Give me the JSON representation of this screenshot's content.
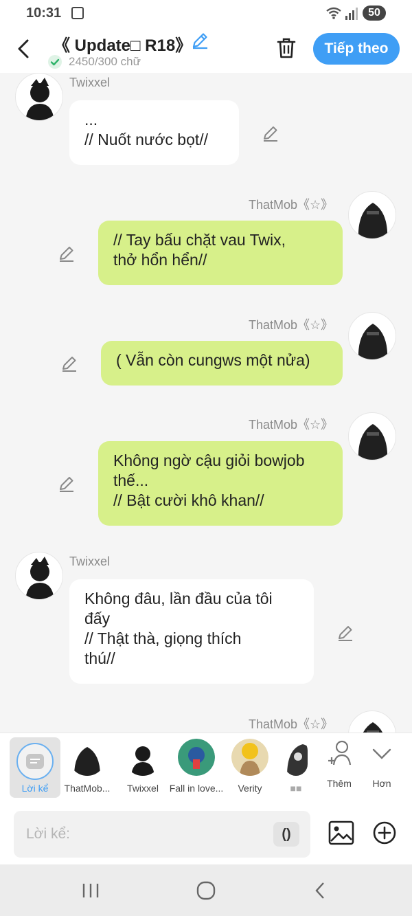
{
  "status": {
    "time": "10:31",
    "battery": "50"
  },
  "header": {
    "title": "《 Update□ R18》",
    "word_count": "2450/300 chữ",
    "next_label": "Tiếp theo"
  },
  "messages": [
    {
      "side": "left",
      "name": "Twixxel",
      "text": "...\n// Nuốt nước bọt//"
    },
    {
      "side": "right",
      "name": "ThatMob《☆》",
      "text": "// Tay bấu chặt vau Twix,\nthở hổn hển//"
    },
    {
      "side": "right",
      "name": "ThatMob《☆》",
      "text": "( Vẫn còn cungws một nửa)"
    },
    {
      "side": "right",
      "name": "ThatMob《☆》",
      "text": "Không ngờ cậu giỏi bowjob\nthế...\n// Bật cười khô khan//"
    },
    {
      "side": "left",
      "name": "Twixxel",
      "text": "Không đâu, lần đầu của tôi\nđấy\n// Thật thà, giọng thích\nthú//"
    },
    {
      "side": "right",
      "name": "ThatMob《☆》",
      "text": ""
    }
  ],
  "charbar": {
    "narrator": "Lời kể",
    "characters": [
      "ThatMob...",
      "Twixxel",
      "Fall in love...",
      "Verity",
      "■■"
    ],
    "more_label": "Thêm",
    "expand_label": "Hơn"
  },
  "input": {
    "placeholder": "Lời kể:",
    "paren": "()"
  },
  "colors": {
    "accent": "#3f9ef5",
    "green_bubble": "#d7f08a"
  }
}
